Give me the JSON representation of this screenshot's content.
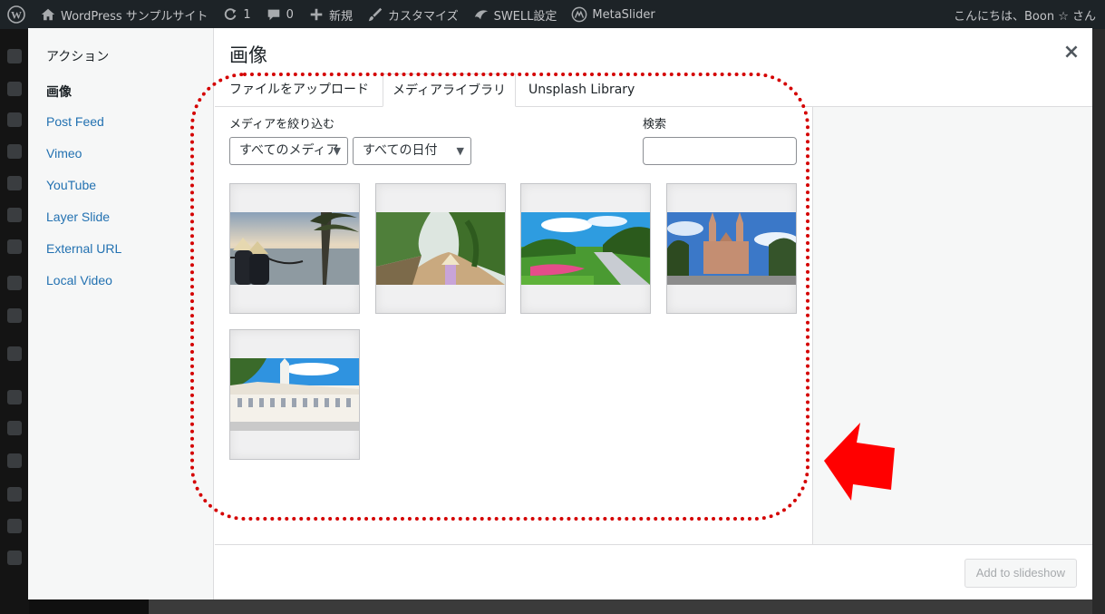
{
  "admin_bar": {
    "site_name": "WordPress サンプルサイト",
    "updates_count": "1",
    "comments_count": "0",
    "new_label": "新規",
    "customize_label": "カスタマイズ",
    "swell_label": "SWELL設定",
    "metaslider_label": "MetaSlider",
    "greeting": "こんにちは、Boon ☆ さん"
  },
  "menu": {
    "heading": "アクション",
    "items": [
      "画像",
      "Post Feed",
      "Vimeo",
      "YouTube",
      "Layer Slide",
      "External URL",
      "Local Video"
    ]
  },
  "frame_title": "画像",
  "close_symbol": "×",
  "tabs": [
    "ファイルをアップロード",
    "メディアライブラリ",
    "Unsplash Library"
  ],
  "filters": {
    "label": "メディアを絞り込む",
    "type_select": "すべてのメディア",
    "date_select": "すべての日付",
    "search_label": "検索",
    "search_value": ""
  },
  "attachments": [
    {
      "name": "beach-hats"
    },
    {
      "name": "tropical-path"
    },
    {
      "name": "park-garden"
    },
    {
      "name": "cathedral"
    },
    {
      "name": "city-hall"
    }
  ],
  "toolbar": {
    "add_button": "Add to slideshow"
  },
  "colors": {
    "annotation": "#d40000",
    "link": "#2271b1",
    "admin_bar": "#1d2327"
  }
}
